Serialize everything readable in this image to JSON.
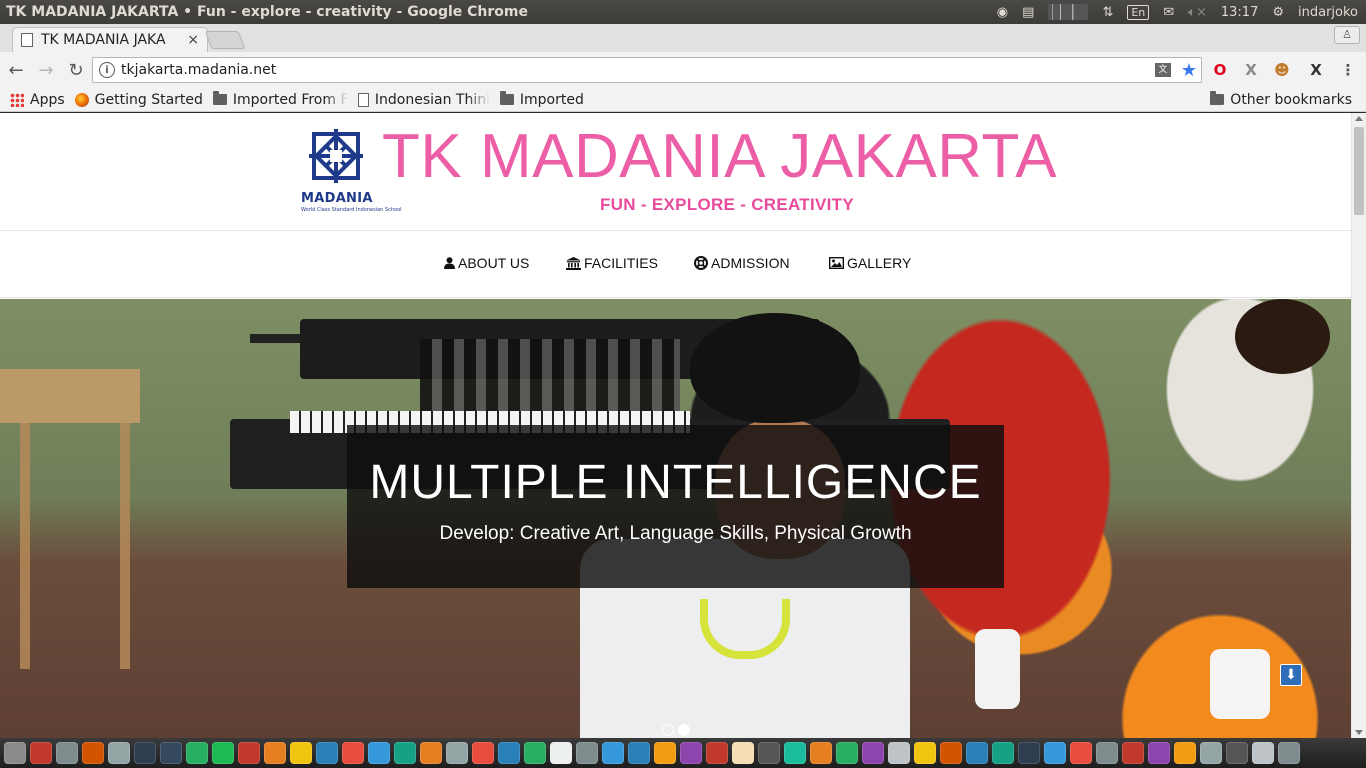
{
  "os": {
    "window_title": "TK MADANIA JAKARTA • Fun - explore - creativity - Google Chrome",
    "clock": "13:17",
    "keyboard_layout": "En",
    "username": "indarjoko"
  },
  "browser": {
    "tab_title": "TK MADANIA JAKA",
    "tab_close": "×",
    "url": "tkjakarta.madania.net",
    "back_icon": "←",
    "forward_icon": "→",
    "reload_icon": "↻",
    "star_icon": "★",
    "extensions": [
      {
        "name": "opera-o-extension-icon",
        "glyph": "O",
        "color": "#e0001b"
      },
      {
        "name": "x-extension-icon",
        "glyph": "X",
        "color": "#888888"
      },
      {
        "name": "face-extension-icon",
        "glyph": "☻",
        "color": "#c27b2b"
      },
      {
        "name": "x-bold-extension-icon",
        "glyph": "X",
        "color": "#333333"
      },
      {
        "name": "menu-icon",
        "glyph": "⋮",
        "color": "#555555"
      }
    ]
  },
  "bookmarks": {
    "items": [
      {
        "label": "Apps",
        "icon": "apps-grid-icon"
      },
      {
        "label": "Getting Started",
        "icon": "firefox-icon"
      },
      {
        "label": "Imported From Fi",
        "icon": "folder-icon"
      },
      {
        "label": "Indonesian Think",
        "icon": "page-icon"
      },
      {
        "label": "Imported",
        "icon": "folder-icon"
      }
    ],
    "other": "Other bookmarks"
  },
  "site": {
    "logo_brand": "MADANIA",
    "logo_tagline": "World Class Standard Indonesian School",
    "title": "TK MADANIA JAKARTA",
    "tagline": "FUN - EXPLORE - CREATIVITY",
    "title_color": "#ec5ea6",
    "nav": [
      {
        "label": "ABOUT US",
        "icon": "user-icon"
      },
      {
        "label": "FACILITIES",
        "icon": "institution-icon"
      },
      {
        "label": "ADMISSION",
        "icon": "lifebuoy-icon"
      },
      {
        "label": "GALLERY",
        "icon": "picture-icon"
      }
    ],
    "slider": {
      "caption_title": "MULTIPLE INTELLIGENCE",
      "caption_subtitle": "Develop: Creative Art, Language Skills, Physical Growth",
      "slide_count": 2,
      "active_slide": 2
    }
  },
  "dock": {
    "icons": [
      "#8a8a8a",
      "#c0392b",
      "#7f8c8d",
      "#d35400",
      "#95a5a6",
      "#2c3e50",
      "#34495e",
      "#27ae60",
      "#1db954",
      "#c0392b",
      "#e67e22",
      "#f1c40f",
      "#2980b9",
      "#e74c3c",
      "#3498db",
      "#16a085",
      "#e67e22",
      "#95a5a6",
      "#e74c3c",
      "#2980b9",
      "#27ae60",
      "#ecf0f1",
      "#7f8c8d",
      "#3498db",
      "#2980b9",
      "#f39c12",
      "#8e44ad",
      "#c0392b",
      "#f5deb3",
      "#555555",
      "#1abc9c",
      "#e67e22",
      "#27ae60",
      "#8e44ad",
      "#bdc3c7",
      "#f1c40f",
      "#d35400",
      "#2980b9",
      "#16a085",
      "#2c3e50",
      "#3498db",
      "#e74c3c",
      "#7f8c8d",
      "#c0392b",
      "#8e44ad",
      "#f39c12",
      "#95a5a6",
      "#555555",
      "#bdc3c7",
      "#7f8c8d"
    ]
  }
}
